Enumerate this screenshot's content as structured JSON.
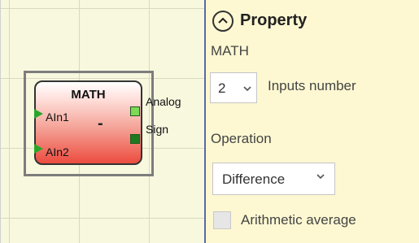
{
  "block": {
    "title": "MATH",
    "operator_symbol": "-",
    "inputs": [
      "AIn1",
      "AIn2"
    ],
    "outputs": [
      "Analog",
      "Sign"
    ],
    "input_arrow_color": "#2aa52a",
    "output_colors": [
      "#7ed957",
      "#1f7a1f"
    ]
  },
  "panel": {
    "title": "Property",
    "collapse_icon": "chevron-up-circle-icon",
    "component_name": "MATH",
    "inputs_number": {
      "value": "2",
      "label": "Inputs number"
    },
    "operation": {
      "label": "Operation",
      "value": "Difference"
    },
    "arithmetic_average": {
      "label": "Arithmetic average",
      "checked": false
    }
  }
}
